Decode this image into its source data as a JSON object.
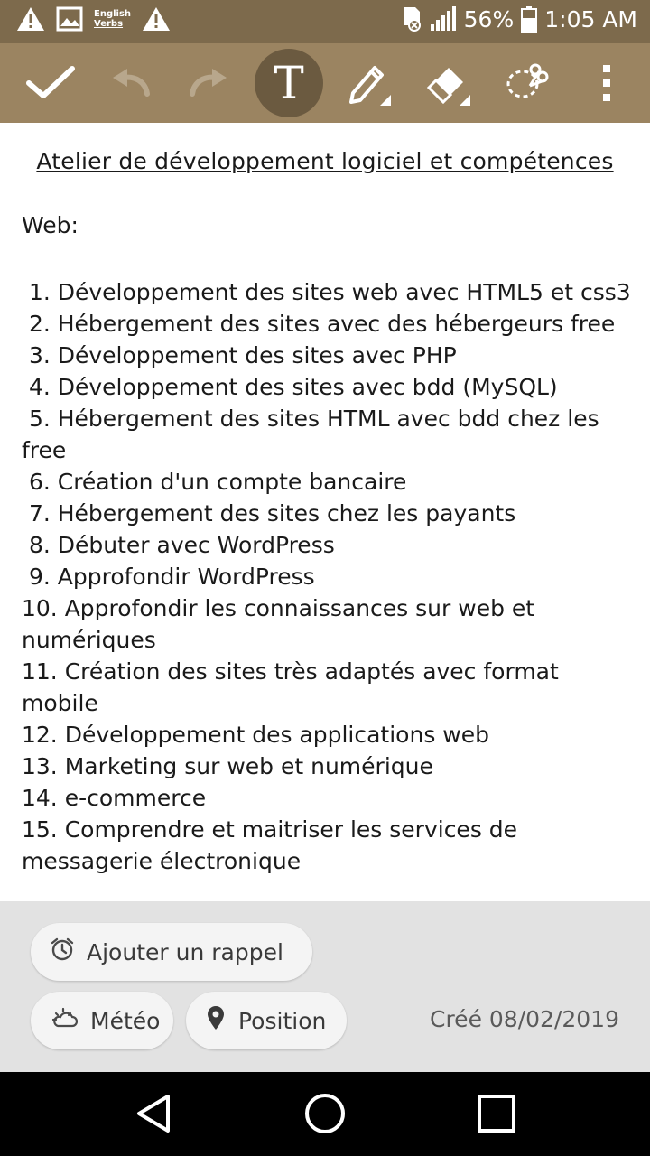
{
  "status_bar": {
    "notification_icons": [
      "warning-icon",
      "image-icon",
      "english-verbs-icon",
      "warning-icon"
    ],
    "english_verbs_line1": "English",
    "english_verbs_line2": "Verbs",
    "battery_percent": "56%",
    "time": "1:05 AM"
  },
  "toolbar": {
    "buttons": [
      "check-icon",
      "undo-icon",
      "redo-icon",
      "text-icon",
      "pen-icon",
      "eraser-icon",
      "lasso-icon",
      "more-vert-icon"
    ],
    "text_tool_glyph": "T",
    "active_tool": "text"
  },
  "note": {
    "title": "Atelier de développement logiciel et compétences",
    "section": "Web:",
    "items": [
      " 1. Développement des sites web avec HTML5 et css3",
      " 2. Hébergement des sites avec des hébergeurs free",
      " 3. Développement des sites avec PHP",
      " 4. Développement des sites avec bdd (MySQL)",
      " 5. Hébergement des sites HTML avec bdd chez les free",
      " 6. Création d'un compte bancaire",
      " 7. Hébergement des sites chez les payants",
      " 8. Débuter avec WordPress",
      " 9. Approfondir WordPress",
      "10. Approfondir les connaissances sur web et numériques",
      "11. Création des sites très adaptés avec format mobile",
      "12. Développement des applications web",
      "13. Marketing sur web et numérique",
      "14. e-commerce",
      "15. Comprendre et maitriser les services de messagerie électronique"
    ]
  },
  "footer": {
    "reminder_label": "Ajouter un rappel",
    "weather_label": "Météo",
    "location_label": "Position",
    "created_label": "Créé 08/02/2019"
  },
  "colors": {
    "status_bar": "#7d6a4c",
    "toolbar": "#9b8461",
    "active_tool": "#6b5a40",
    "footer": "#e2e2e2",
    "nav_bar": "#000000"
  }
}
